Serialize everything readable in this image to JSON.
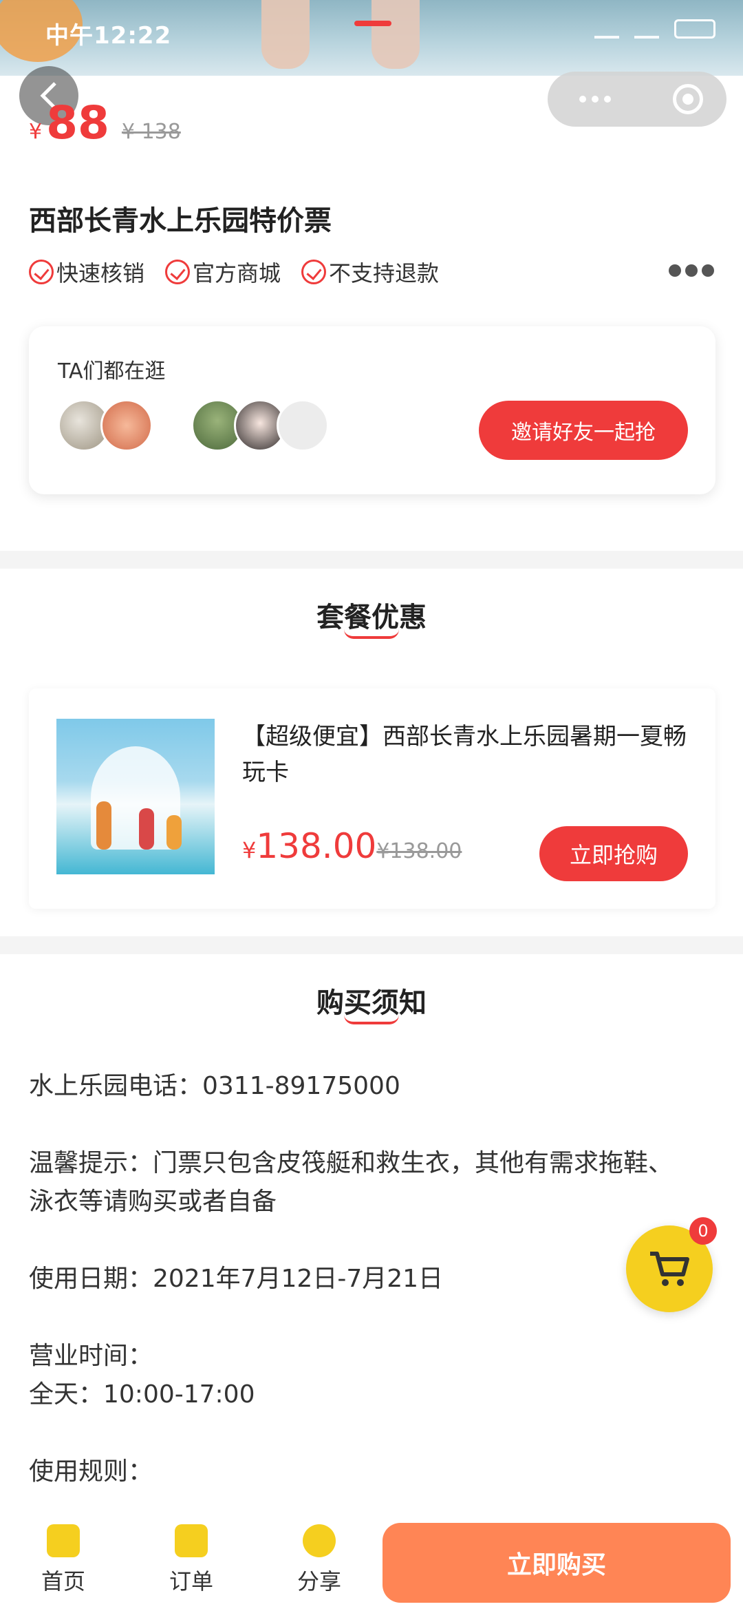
{
  "status_bar": {
    "time": "中午12:22"
  },
  "product": {
    "currency": "¥",
    "price": "88",
    "original_price": "¥ 138",
    "title": "西部长青水上乐园特价票",
    "tags": [
      "快速核销",
      "官方商城",
      "不支持退款"
    ]
  },
  "social": {
    "label": "TA们都在逛",
    "invite_button": "邀请好友一起抢"
  },
  "package_section": {
    "title": "套餐优惠",
    "item": {
      "name": "【超级便宜】西部长青水上乐园暑期一夏畅玩卡",
      "currency": "¥",
      "price": "138.00",
      "original_price": "¥138.00",
      "button": "立即抢购"
    }
  },
  "notice_section": {
    "title": "购买须知",
    "lines": [
      "水上乐园电话：0311-89175000",
      "温馨提示：门票只包含皮筏艇和救生衣，其他有需求拖鞋、泳衣等请购买或者自备",
      "使用日期：2021年7月12日-7月21日",
      "营业时间：",
      "全天：10:00-17:00",
      "使用规则："
    ]
  },
  "cart": {
    "count": "0"
  },
  "bottom_nav": {
    "tabs": [
      {
        "label": "首页",
        "icon": "bag-icon"
      },
      {
        "label": "订单",
        "icon": "order-icon"
      },
      {
        "label": "分享",
        "icon": "share-icon"
      }
    ],
    "buy_button": "立即购买"
  },
  "colors": {
    "accent": "#ef3b3b",
    "buy": "#ff8555",
    "cart": "#f5cf1f"
  }
}
